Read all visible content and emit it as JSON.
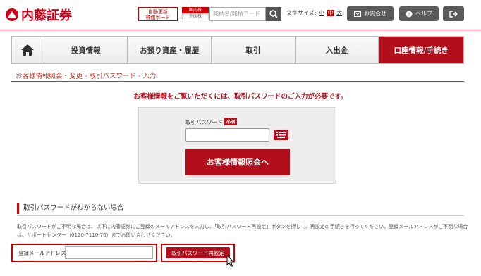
{
  "header": {
    "logo_text": "内藤証券",
    "auto_update_label": "自動更新\n株価ボード",
    "market_domestic": "国内株",
    "market_foreign": "外国株",
    "search_placeholder": "銘柄名/銘柄コード",
    "font_size_label": "文字サイズ:",
    "font_sizes": [
      "小",
      "中",
      "大"
    ],
    "contact_label": "お問合せ",
    "help_label": "ヘルプ"
  },
  "nav": {
    "items": [
      "投資情報",
      "お預り資産・履歴",
      "取引",
      "入出金",
      "口座情報/手続き"
    ]
  },
  "breadcrumb": "お客様情報照会・変更 - 取引パスワード - 入力",
  "notice": "お客様情報をご覧いただくには、取引パスワードのご入力が必要です。",
  "login": {
    "password_label": "取引パスワード",
    "required_badge": "必須",
    "submit_label": "お客様情報照会へ"
  },
  "forgot": {
    "title": "取引パスワードがわからない場合",
    "description": "取引パスワードがご不明な場合は、以下に内藤証券にご登録のメールアドレスを入力し、「取引パスワード再設定」ボタンを押して、再設定の手続きを行ってください。登録メールアドレスがご不明な場合は、サポートセンター（0120-7110-76）までお問い合わせください。",
    "email_label": "登録メールアドレス",
    "reset_label": "取引パスワード再設定"
  },
  "colors": {
    "brand": "#b30e1c",
    "accent": "#c00"
  }
}
